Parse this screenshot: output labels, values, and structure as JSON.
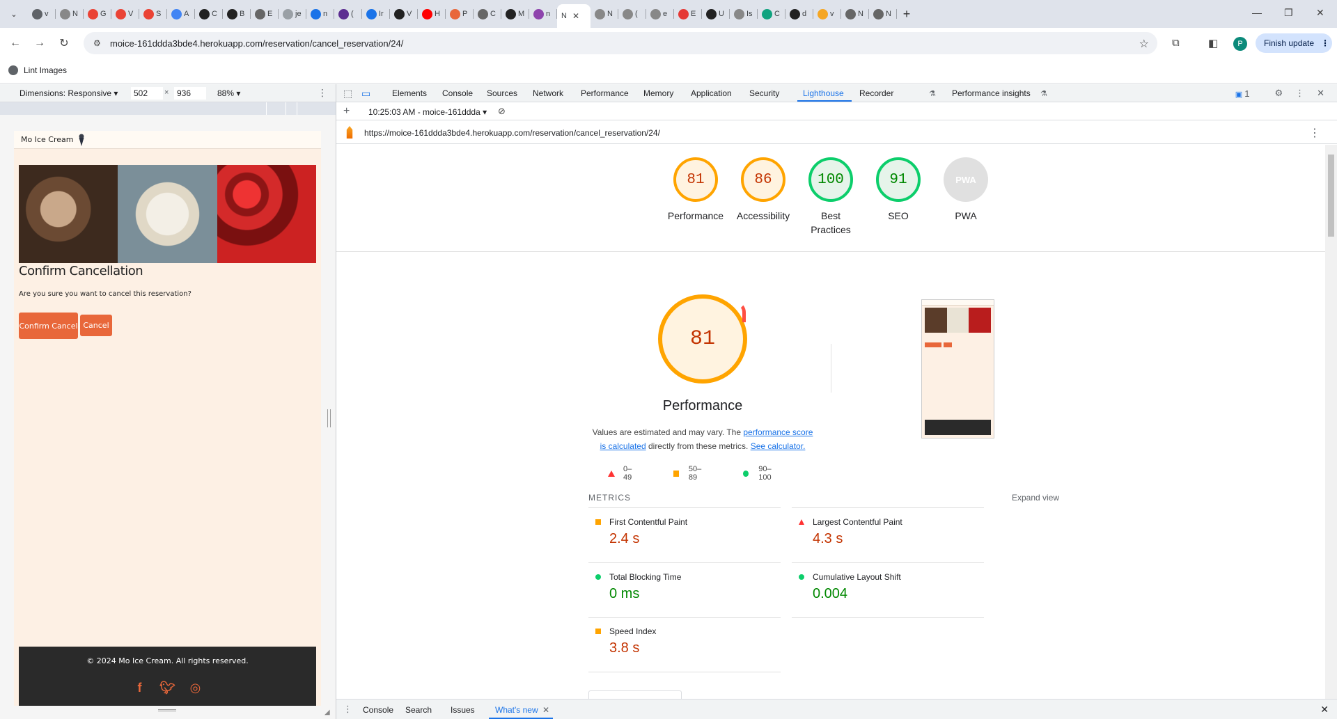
{
  "browser": {
    "tabs": [
      {
        "label": "v",
        "color": "#5f6368"
      },
      {
        "label": "N",
        "color": "#888"
      },
      {
        "label": "G",
        "color": "#ea4335"
      },
      {
        "label": "V",
        "color": "#ea4335"
      },
      {
        "label": "S",
        "color": "#ea4335"
      },
      {
        "label": "A",
        "color": "#4285f4"
      },
      {
        "label": "C",
        "color": "#222"
      },
      {
        "label": "B",
        "color": "#222"
      },
      {
        "label": "E",
        "color": "#666"
      },
      {
        "label": "je",
        "color": "#9aa0a6"
      },
      {
        "label": "n",
        "color": "#1a73e8"
      },
      {
        "label": "(",
        "color": "#5c2d91"
      },
      {
        "label": "Ir",
        "color": "#1a73e8"
      },
      {
        "label": "V",
        "color": "#222"
      },
      {
        "label": "H",
        "color": "#ff0000"
      },
      {
        "label": "P",
        "color": "#e8673a"
      },
      {
        "label": "C",
        "color": "#666"
      },
      {
        "label": "M",
        "color": "#222"
      },
      {
        "label": "n",
        "color": "#8e44ad"
      }
    ],
    "active_tab": {
      "label": "N",
      "close": "✕"
    },
    "tabs_after": [
      {
        "label": "N",
        "color": "#888"
      },
      {
        "label": "(",
        "color": "#888"
      },
      {
        "label": "e",
        "color": "#888"
      },
      {
        "label": "E",
        "color": "#e53935"
      },
      {
        "label": "U",
        "color": "#222"
      },
      {
        "label": "Is",
        "color": "#888"
      },
      {
        "label": "C",
        "color": "#10a37f"
      },
      {
        "label": "d",
        "color": "#222"
      },
      {
        "label": "v",
        "color": "#f5a623"
      },
      {
        "label": "N",
        "color": "#666"
      },
      {
        "label": "N",
        "color": "#666"
      }
    ],
    "url": "moice-161ddda3bde4.herokuapp.com/reservation/cancel_reservation/24/",
    "profile_initial": "P",
    "finish_update": "Finish update",
    "bookmark": "Lint Images"
  },
  "device_toolbar": {
    "dimensions_label": "Dimensions: Responsive ▾",
    "width": "502",
    "height": "936",
    "times": "×",
    "zoom": "88% ▾"
  },
  "site": {
    "brand": "Mo Ice Cream",
    "heading": "Confirm Cancellation",
    "question": "Are you sure you want to cancel this reservation?",
    "confirm_button": "Confirm Cancel",
    "cancel_button": "Cancel",
    "footer_text": "© 2024 Mo Ice Cream. All rights reserved.",
    "social": [
      "facebook-icon",
      "twitter-icon",
      "instagram-icon"
    ]
  },
  "devtools": {
    "tabs": [
      "Elements",
      "Console",
      "Sources",
      "Network",
      "Performance",
      "Memory",
      "Application",
      "Security",
      "Lighthouse",
      "Recorder",
      "Performance insights"
    ],
    "active_tab": "Lighthouse",
    "issues_count": "1",
    "report_select": "10:25:03 AM - moice-161ddda ▾",
    "report_url": "https://moice-161ddda3bde4.herokuapp.com/reservation/cancel_reservation/24/"
  },
  "lighthouse": {
    "scores": [
      {
        "label": "Performance",
        "value": "81",
        "status": "average"
      },
      {
        "label": "Accessibility",
        "value": "86",
        "status": "average"
      },
      {
        "label": "Best Practices",
        "value": "100",
        "status": "pass"
      },
      {
        "label": "SEO",
        "value": "91",
        "status": "pass"
      },
      {
        "label": "PWA",
        "value": "PWA",
        "status": "na"
      }
    ],
    "main_score": "81",
    "main_title": "Performance",
    "desc_pre": "Values are estimated and may vary. The ",
    "desc_link1": "performance score is calculated",
    "desc_mid": " directly from these metrics. ",
    "desc_link2": "See calculator.",
    "legend": [
      "0–49",
      "50–89",
      "90–100"
    ],
    "metrics_header": "METRICS",
    "expand": "Expand view",
    "metrics": [
      {
        "name": "First Contentful Paint",
        "value": "2.4 s",
        "status": "average"
      },
      {
        "name": "Largest Contentful Paint",
        "value": "4.3 s",
        "status": "fail"
      },
      {
        "name": "Total Blocking Time",
        "value": "0 ms",
        "status": "pass"
      },
      {
        "name": "Cumulative Layout Shift",
        "value": "0.004",
        "status": "pass"
      },
      {
        "name": "Speed Index",
        "value": "3.8 s",
        "status": "average"
      }
    ]
  },
  "drawer": {
    "tabs": [
      "Console",
      "Search",
      "Issues",
      "What's new"
    ],
    "active": "What's new"
  }
}
